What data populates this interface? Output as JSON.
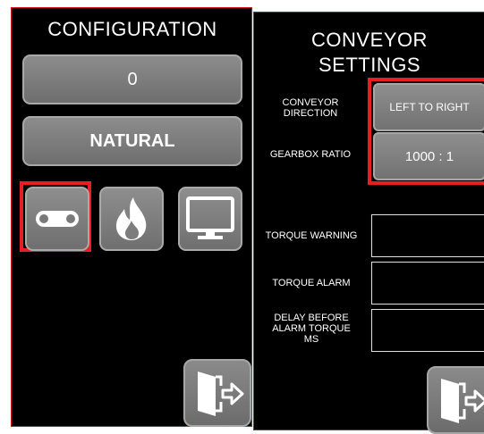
{
  "configuration": {
    "title": "CONFIGURATION",
    "value": "0",
    "mode": "NATURAL",
    "icons": [
      "conveyor-icon",
      "fire-icon",
      "monitor-icon"
    ],
    "exit_icon": "exit-door-icon"
  },
  "conveyor_settings": {
    "title_line1": "CONVEYOR",
    "title_line2": "SETTINGS",
    "direction_label_line1": "CONVEYOR",
    "direction_label_line2": "DIRECTION",
    "direction_value": "LEFT TO RIGHT",
    "gearbox_label": "GEARBOX RATIO",
    "gearbox_value": "1000 : 1",
    "torque_warning_label": "TORQUE WARNING",
    "torque_warning_value": "",
    "torque_alarm_label": "TORQUE ALARM",
    "torque_alarm_value": "",
    "delay_label_line1": "DELAY BEFORE",
    "delay_label_line2": "ALARM TORQUE",
    "delay_label_line3": "MS",
    "delay_value": "",
    "exit_icon": "exit-door-icon"
  },
  "colors": {
    "panel_bg": "#000000",
    "button_gray": "#7d7d7d",
    "highlight_red": "#e81d25"
  }
}
